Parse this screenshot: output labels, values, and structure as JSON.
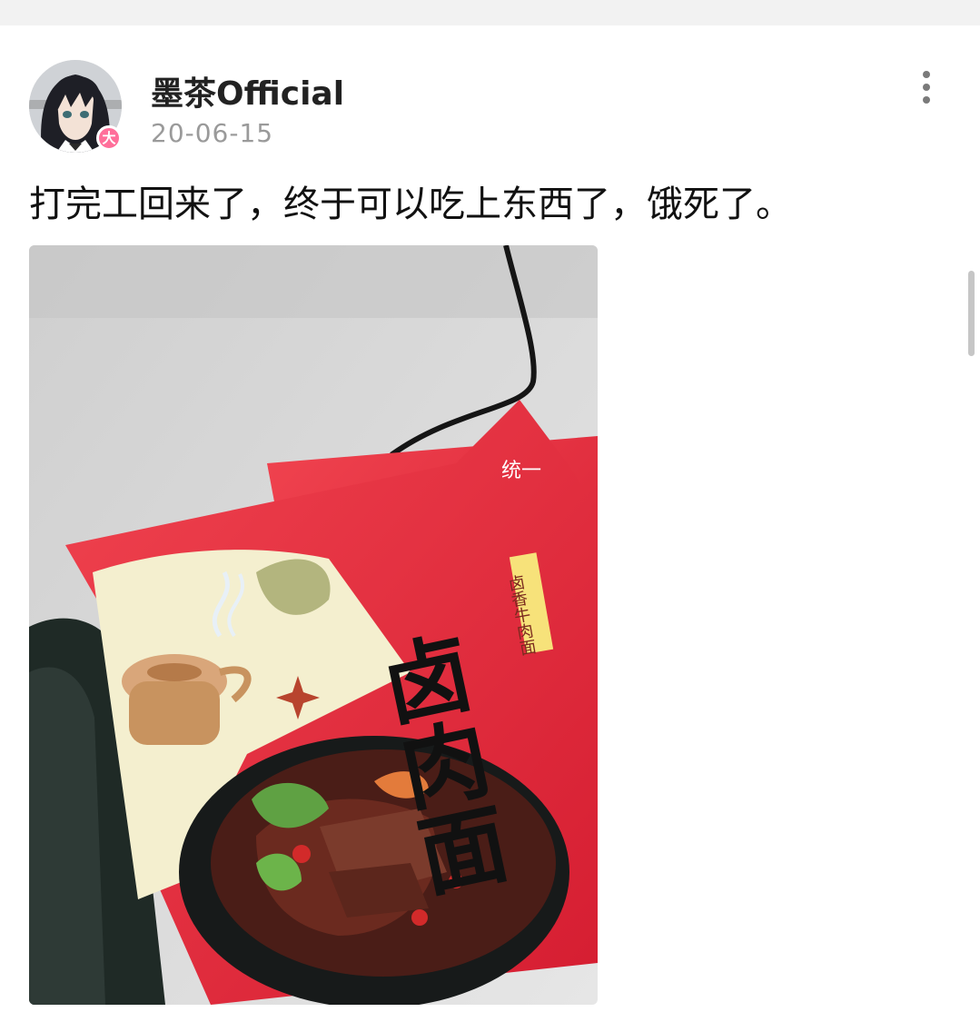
{
  "post": {
    "author": "墨茶Official",
    "badge": "大",
    "date": "20-06-15",
    "text": "打完工回来了，终于可以吃上东西了，饿死了。"
  },
  "photo": {
    "package_brand": "统一",
    "package_flavor": "卤肉面",
    "package_subtitle": "卤香牛肉面"
  },
  "icons": {
    "more": "vertical-ellipsis-icon",
    "avatar": "anime-girl-avatar",
    "badge": "vip-badge-icon"
  },
  "colors": {
    "badge": "#ff6f9a",
    "date": "#9a9a9a",
    "package_red": "#e8243a"
  }
}
